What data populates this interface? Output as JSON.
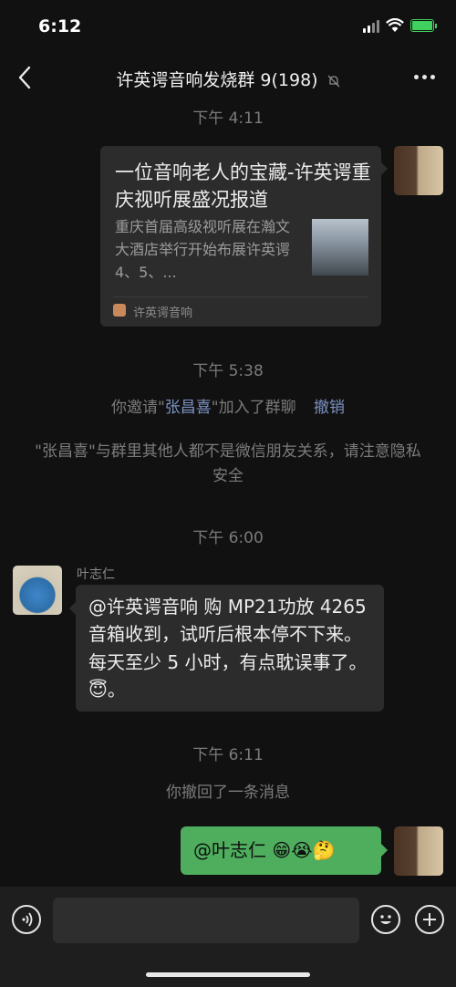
{
  "status": {
    "time": "6:12"
  },
  "header": {
    "title": "许英谔音响发烧群 9(198)"
  },
  "timestamps": [
    "下午 4:11",
    "下午 5:38",
    "下午 6:00",
    "下午 6:11"
  ],
  "link_card": {
    "title": "一位音响老人的宝藏-许英谔重庆视听展盛况报道",
    "description": "重庆首届高级视听展在瀚文大酒店举行开始布展许英谔 4、5、...",
    "source": "许英谔音响"
  },
  "system": {
    "invite_prefix": "你邀请\"",
    "invite_name": "张昌喜",
    "invite_suffix": "\"加入了群聊",
    "invite_undo": "撤销",
    "privacy_notice": "\"张昌喜\"与群里其他人都不是微信朋友关系，请注意隐私安全",
    "recall_notice": "你撤回了一条消息"
  },
  "messages": {
    "ye": {
      "sender": "叶志仁",
      "text": "@许英谔音响 购 MP21功放 4265 音箱收到，试听后根本停不下来。每天至少 5 小时，有点耽误事了。😇。"
    },
    "me": {
      "text": "@叶志仁 😁😭🤔"
    }
  },
  "input": {
    "placeholder": ""
  },
  "colors": {
    "background": "#111111",
    "bubble_other": "#2c2c2c",
    "bubble_self": "#4fae5e",
    "link": "#7c92c4",
    "system_text": "#7b7b7b"
  },
  "icons": [
    "back-arrow-icon",
    "mute-bell-icon",
    "more-icon",
    "voice-icon",
    "emoji-icon",
    "plus-icon"
  ]
}
